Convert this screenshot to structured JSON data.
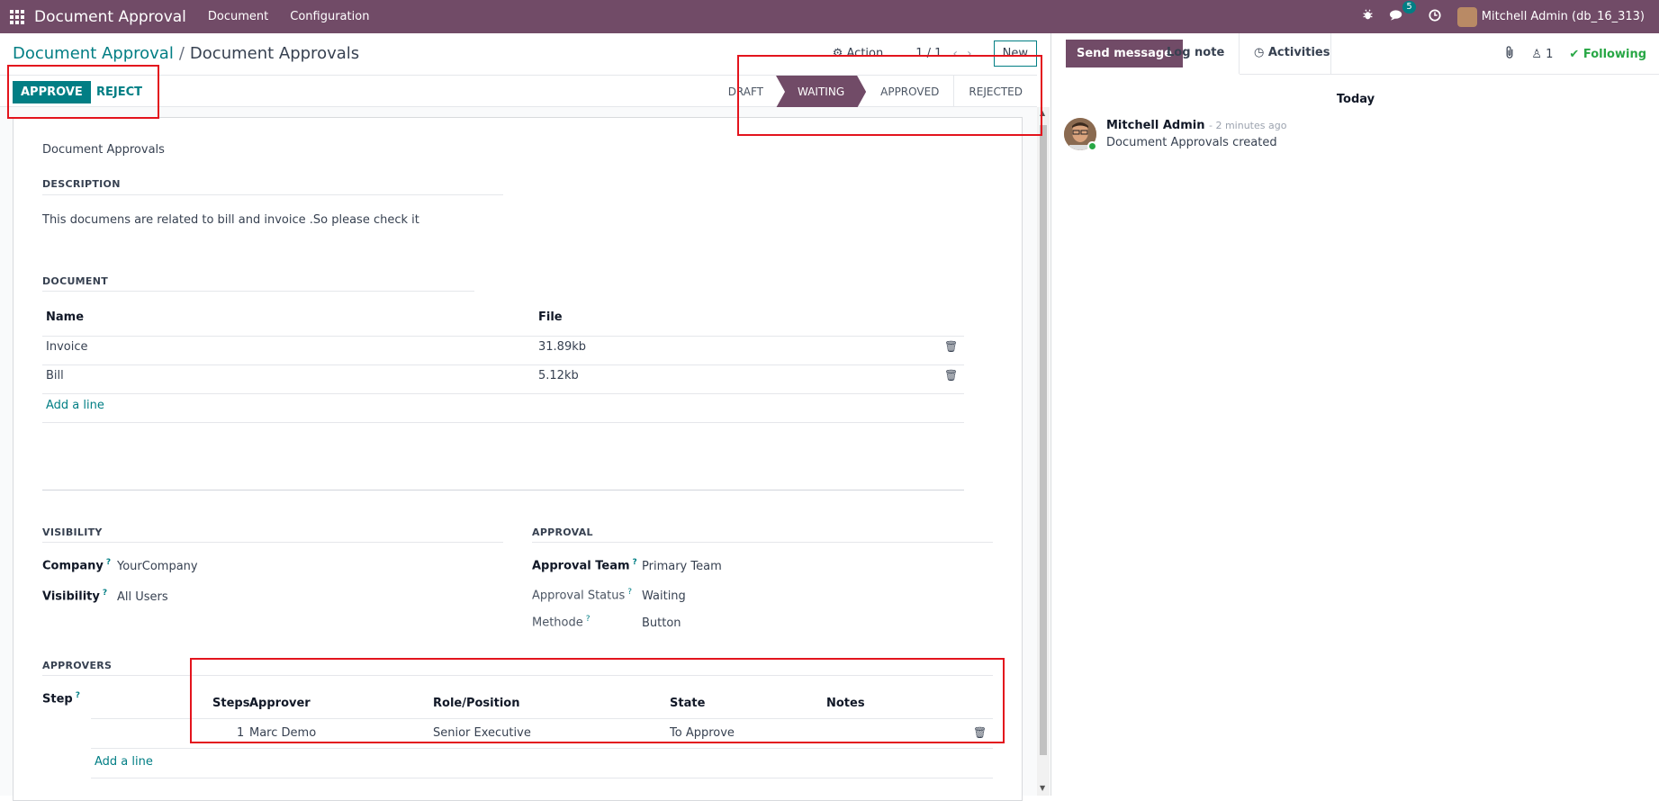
{
  "topbar": {
    "app_name": "Document Approval",
    "menu": [
      "Document",
      "Configuration"
    ],
    "messages_badge": "5",
    "user": "Mitchell Admin (db_16_313)"
  },
  "control_panel": {
    "breadcrumb_parent": "Document Approval",
    "breadcrumb_sep": "/",
    "breadcrumb_current": "Document Approvals",
    "action_label": "Action",
    "pager": "1 / 1",
    "new_label": "New"
  },
  "statusbar": {
    "approve_label": "APPROVE",
    "reject_label": "REJECT",
    "stages": [
      "DRAFT",
      "WAITING",
      "APPROVED",
      "REJECTED"
    ],
    "active_stage": "WAITING"
  },
  "form": {
    "name": "Document Approvals",
    "description_header": "DESCRIPTION",
    "description": "This documens are related to bill and invoice .So please check it",
    "document_header": "DOCUMENT",
    "document_columns": [
      "Name",
      "File"
    ],
    "documents": [
      {
        "name": "Invoice",
        "file": "31.89kb"
      },
      {
        "name": "Bill",
        "file": "5.12kb"
      }
    ],
    "add_line": "Add a line",
    "visibility_header": "VISIBILITY",
    "company_label": "Company",
    "company_value": "YourCompany",
    "visibility_label": "Visibility",
    "visibility_value": "All Users",
    "approval_header": "APPROVAL",
    "approval_team_label": "Approval Team",
    "approval_team_value": "Primary Team",
    "approval_status_label": "Approval Status",
    "approval_status_value": "Waiting",
    "methode_label": "Methode",
    "methode_value": "Button",
    "approvers_header": "APPROVERS",
    "step_label": "Step",
    "approver_columns": [
      "Steps",
      "Approver",
      "Role/Position",
      "State",
      "Notes"
    ],
    "approvers": [
      {
        "step": "1",
        "approver": "Marc Demo",
        "role": "Senior Executive",
        "state": "To Approve",
        "notes": ""
      }
    ],
    "approver_add_line": "Add a line"
  },
  "chatter": {
    "send_message": "Send message",
    "log_note": "Log note",
    "activities": "Activities",
    "followers_count": "1",
    "following": "Following",
    "day": "Today",
    "message": {
      "author": "Mitchell Admin",
      "time": "- 2 minutes ago",
      "body": "Document Approvals created"
    }
  },
  "colors": {
    "brand": "#714b67",
    "accent": "#017e84",
    "highlight_box": "#e3141d"
  },
  "icons": [
    "apps-grid-icon",
    "bug-icon",
    "chat-icon",
    "clock-icon",
    "gear-icon",
    "chevron-left-icon",
    "chevron-right-icon",
    "trash-icon",
    "paperclip-icon",
    "user-icon",
    "check-icon"
  ]
}
